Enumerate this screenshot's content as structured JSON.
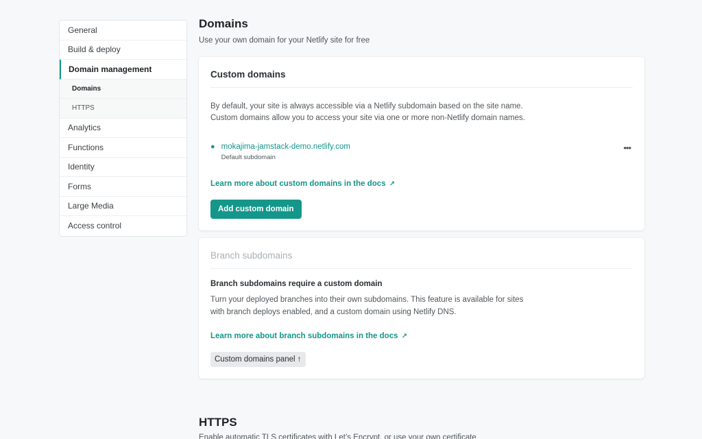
{
  "sidebar": {
    "items": [
      {
        "label": "General"
      },
      {
        "label": "Build & deploy"
      },
      {
        "label": "Domain management"
      },
      {
        "label": "Analytics"
      },
      {
        "label": "Functions"
      },
      {
        "label": "Identity"
      },
      {
        "label": "Forms"
      },
      {
        "label": "Large Media"
      },
      {
        "label": "Access control"
      }
    ],
    "subitems": [
      {
        "label": "Domains"
      },
      {
        "label": "HTTPS"
      }
    ]
  },
  "page": {
    "title": "Domains",
    "subtitle": "Use your own domain for your Netlify site for free"
  },
  "custom_domains": {
    "title": "Custom domains",
    "description_line1": "By default, your site is always accessible via a Netlify subdomain based on the site name.",
    "description_line2": "Custom domains allow you to access your site via one or more non-Netlify domain names.",
    "domain": "mokajima-jamstack-demo.netlify.com",
    "domain_label": "Default subdomain",
    "learn_more": "Learn more about custom domains in the docs",
    "add_button": "Add custom domain"
  },
  "branch_subdomains": {
    "title": "Branch subdomains",
    "heading": "Branch subdomains require a custom domain",
    "description_line1": "Turn your deployed branches into their own subdomains. This feature is available for sites",
    "description_line2": "with branch deploys enabled, and a custom domain using Netlify DNS.",
    "learn_more": "Learn more about branch subdomains in the docs",
    "panel_button": "Custom domains panel ↑"
  },
  "https": {
    "title": "HTTPS",
    "subtitle": "Enable automatic TLS certificates with Let’s Encrypt, or use your own certificate"
  },
  "colors": {
    "accent": "#14968a",
    "background": "#f6f8f9"
  },
  "icons": {
    "external_link": "↗",
    "more": "•••"
  }
}
